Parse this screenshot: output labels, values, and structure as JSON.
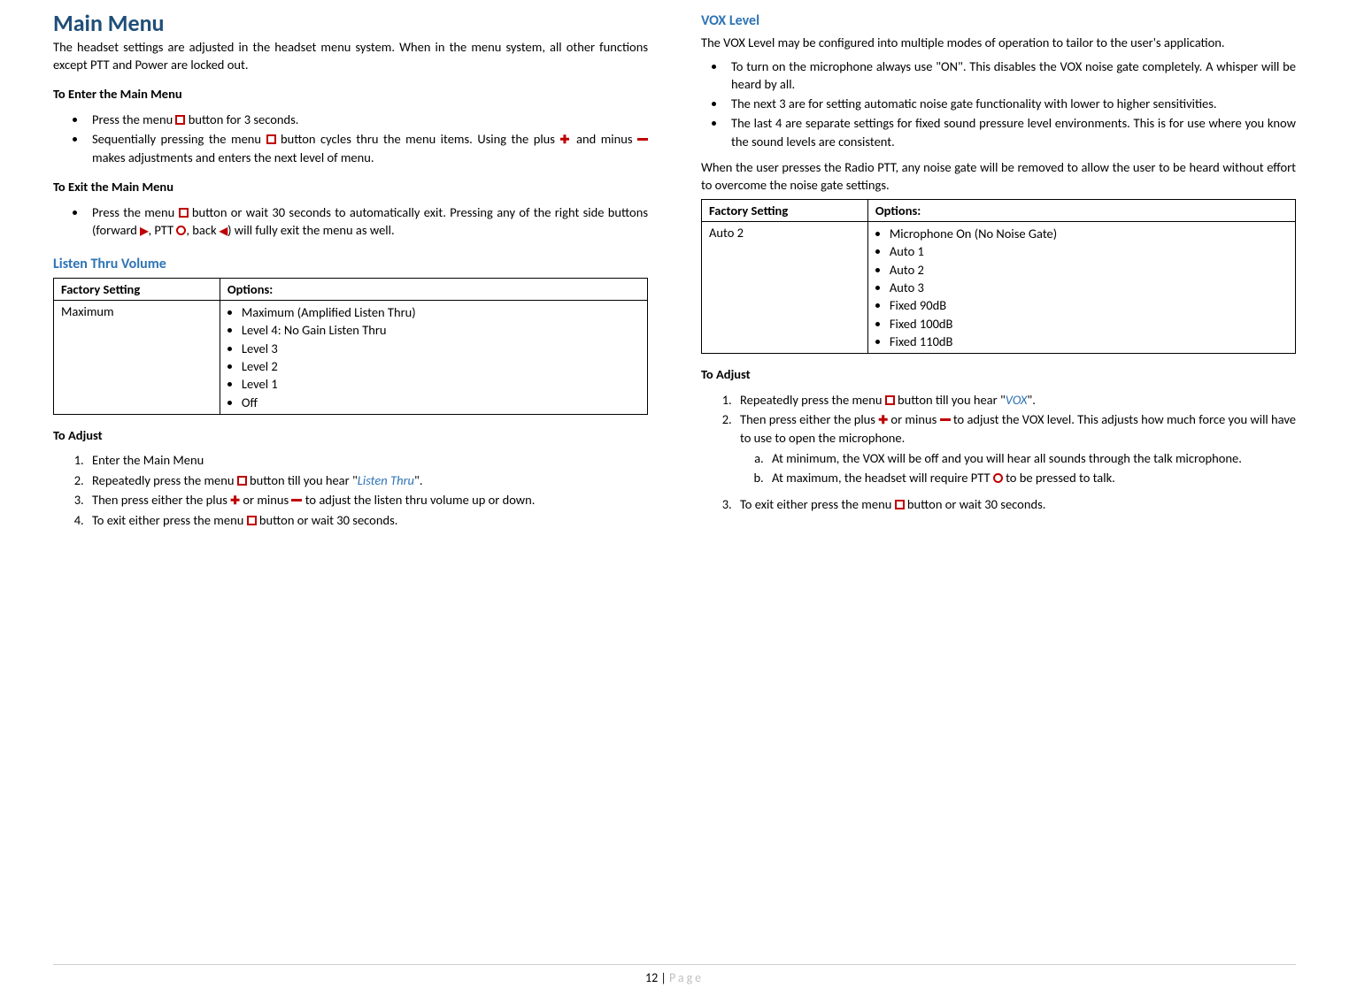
{
  "left": {
    "mainTitle": "Main Menu",
    "intro": "The headset settings are adjusted in the headset menu system. When in the menu system, all other functions except PTT and Power are locked out.",
    "enterHead": "To Enter the Main Menu",
    "enter1_a": "Press the menu ",
    "enter1_b": " button for 3 seconds.",
    "enter2_a": "Sequentially pressing the menu ",
    "enter2_b": " button cycles thru the menu items. Using the plus ",
    "enter2_c": " and minus ",
    "enter2_d": " makes adjustments and enters the next level of menu.",
    "exitHead": "To Exit the Main Menu",
    "exit1_a": "Press the menu ",
    "exit1_b": " button or wait 30 seconds to automatically exit. Pressing any of the right side buttons (forward ",
    "exit1_c": ", PTT ",
    "exit1_d": ", back ",
    "exit1_e": ") will fully exit the menu as well.",
    "listenTitle": "Listen Thru Volume",
    "tbl": {
      "h1": "Factory Setting",
      "h2": "Options:",
      "factory": "Maximum",
      "opts": [
        "Maximum (Amplified Listen Thru)",
        "Level 4: No Gain Listen Thru",
        "Level 3",
        "Level 2",
        "Level 1",
        "Off"
      ]
    },
    "adjHead": "To Adjust",
    "adj1": "Enter the Main Menu",
    "adj2_a": "Repeatedly press the menu ",
    "adj2_b": " button till you hear \"",
    "adj2_term": "Listen Thru",
    "adj2_c": "\".",
    "adj3_a": "Then press either the plus ",
    "adj3_b": " or minus ",
    "adj3_c": " to adjust the listen thru volume up or down.",
    "adj4_a": "To exit either press the menu ",
    "adj4_b": " button or wait 30 seconds."
  },
  "right": {
    "voxTitle": "VOX Level",
    "voxIntro": "The VOX Level may be configured into multiple modes of operation to tailor to the user's application.",
    "b1": "To turn on the microphone always use \"ON\". This disables the VOX noise gate completely. A whisper will be heard by all.",
    "b2": "The next 3 are for setting automatic noise gate functionality with lower to higher sensitivities.",
    "b3": "The last 4 are separate settings for fixed sound pressure level environments. This is for use where you know the sound levels are consistent.",
    "voxNote": "When the user presses the Radio PTT, any noise gate will be removed to allow the user to be heard without effort to overcome the noise gate settings.",
    "tbl": {
      "h1": "Factory Setting",
      "h2": "Options:",
      "factory": "Auto 2",
      "opts": [
        "Microphone On (No Noise Gate)",
        "Auto 1",
        "Auto 2",
        "Auto 3",
        "Fixed 90dB",
        "Fixed 100dB",
        "Fixed 110dB"
      ]
    },
    "adjHead": "To Adjust",
    "s1_a": "Repeatedly press the menu ",
    "s1_b": " button till you hear \"",
    "s1_term": "VOX",
    "s1_c": "\".",
    "s2_a": "Then press either the plus ",
    "s2_b": " or minus ",
    "s2_c": " to adjust the VOX level. This adjusts how much force you will have to use to open the microphone.",
    "s2a_a": "At minimum, the VOX will be off and you will hear all sounds through the talk microphone.",
    "s2b_a": "At maximum, the headset will require PTT ",
    "s2b_b": " to be pressed to talk.",
    "s3_a": "To exit either press the menu ",
    "s3_b": " button or wait 30 seconds."
  },
  "footer": {
    "num": "12",
    "sep": " | ",
    "page": "Page"
  }
}
